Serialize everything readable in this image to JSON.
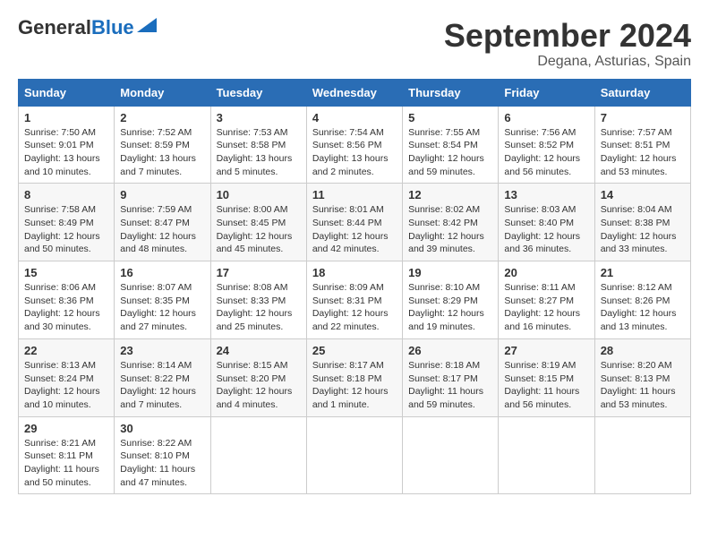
{
  "header": {
    "logo_general": "General",
    "logo_blue": "Blue",
    "month_title": "September 2024",
    "location": "Degana, Asturias, Spain"
  },
  "days_of_week": [
    "Sunday",
    "Monday",
    "Tuesday",
    "Wednesday",
    "Thursday",
    "Friday",
    "Saturday"
  ],
  "weeks": [
    [
      {
        "day": "1",
        "sunrise": "7:50 AM",
        "sunset": "9:01 PM",
        "daylight": "13 hours and 10 minutes."
      },
      {
        "day": "2",
        "sunrise": "7:52 AM",
        "sunset": "8:59 PM",
        "daylight": "13 hours and 7 minutes."
      },
      {
        "day": "3",
        "sunrise": "7:53 AM",
        "sunset": "8:58 PM",
        "daylight": "13 hours and 5 minutes."
      },
      {
        "day": "4",
        "sunrise": "7:54 AM",
        "sunset": "8:56 PM",
        "daylight": "13 hours and 2 minutes."
      },
      {
        "day": "5",
        "sunrise": "7:55 AM",
        "sunset": "8:54 PM",
        "daylight": "12 hours and 59 minutes."
      },
      {
        "day": "6",
        "sunrise": "7:56 AM",
        "sunset": "8:52 PM",
        "daylight": "12 hours and 56 minutes."
      },
      {
        "day": "7",
        "sunrise": "7:57 AM",
        "sunset": "8:51 PM",
        "daylight": "12 hours and 53 minutes."
      }
    ],
    [
      {
        "day": "8",
        "sunrise": "7:58 AM",
        "sunset": "8:49 PM",
        "daylight": "12 hours and 50 minutes."
      },
      {
        "day": "9",
        "sunrise": "7:59 AM",
        "sunset": "8:47 PM",
        "daylight": "12 hours and 48 minutes."
      },
      {
        "day": "10",
        "sunrise": "8:00 AM",
        "sunset": "8:45 PM",
        "daylight": "12 hours and 45 minutes."
      },
      {
        "day": "11",
        "sunrise": "8:01 AM",
        "sunset": "8:44 PM",
        "daylight": "12 hours and 42 minutes."
      },
      {
        "day": "12",
        "sunrise": "8:02 AM",
        "sunset": "8:42 PM",
        "daylight": "12 hours and 39 minutes."
      },
      {
        "day": "13",
        "sunrise": "8:03 AM",
        "sunset": "8:40 PM",
        "daylight": "12 hours and 36 minutes."
      },
      {
        "day": "14",
        "sunrise": "8:04 AM",
        "sunset": "8:38 PM",
        "daylight": "12 hours and 33 minutes."
      }
    ],
    [
      {
        "day": "15",
        "sunrise": "8:06 AM",
        "sunset": "8:36 PM",
        "daylight": "12 hours and 30 minutes."
      },
      {
        "day": "16",
        "sunrise": "8:07 AM",
        "sunset": "8:35 PM",
        "daylight": "12 hours and 27 minutes."
      },
      {
        "day": "17",
        "sunrise": "8:08 AM",
        "sunset": "8:33 PM",
        "daylight": "12 hours and 25 minutes."
      },
      {
        "day": "18",
        "sunrise": "8:09 AM",
        "sunset": "8:31 PM",
        "daylight": "12 hours and 22 minutes."
      },
      {
        "day": "19",
        "sunrise": "8:10 AM",
        "sunset": "8:29 PM",
        "daylight": "12 hours and 19 minutes."
      },
      {
        "day": "20",
        "sunrise": "8:11 AM",
        "sunset": "8:27 PM",
        "daylight": "12 hours and 16 minutes."
      },
      {
        "day": "21",
        "sunrise": "8:12 AM",
        "sunset": "8:26 PM",
        "daylight": "12 hours and 13 minutes."
      }
    ],
    [
      {
        "day": "22",
        "sunrise": "8:13 AM",
        "sunset": "8:24 PM",
        "daylight": "12 hours and 10 minutes."
      },
      {
        "day": "23",
        "sunrise": "8:14 AM",
        "sunset": "8:22 PM",
        "daylight": "12 hours and 7 minutes."
      },
      {
        "day": "24",
        "sunrise": "8:15 AM",
        "sunset": "8:20 PM",
        "daylight": "12 hours and 4 minutes."
      },
      {
        "day": "25",
        "sunrise": "8:17 AM",
        "sunset": "8:18 PM",
        "daylight": "12 hours and 1 minute."
      },
      {
        "day": "26",
        "sunrise": "8:18 AM",
        "sunset": "8:17 PM",
        "daylight": "11 hours and 59 minutes."
      },
      {
        "day": "27",
        "sunrise": "8:19 AM",
        "sunset": "8:15 PM",
        "daylight": "11 hours and 56 minutes."
      },
      {
        "day": "28",
        "sunrise": "8:20 AM",
        "sunset": "8:13 PM",
        "daylight": "11 hours and 53 minutes."
      }
    ],
    [
      {
        "day": "29",
        "sunrise": "8:21 AM",
        "sunset": "8:11 PM",
        "daylight": "11 hours and 50 minutes."
      },
      {
        "day": "30",
        "sunrise": "8:22 AM",
        "sunset": "8:10 PM",
        "daylight": "11 hours and 47 minutes."
      },
      null,
      null,
      null,
      null,
      null
    ]
  ]
}
